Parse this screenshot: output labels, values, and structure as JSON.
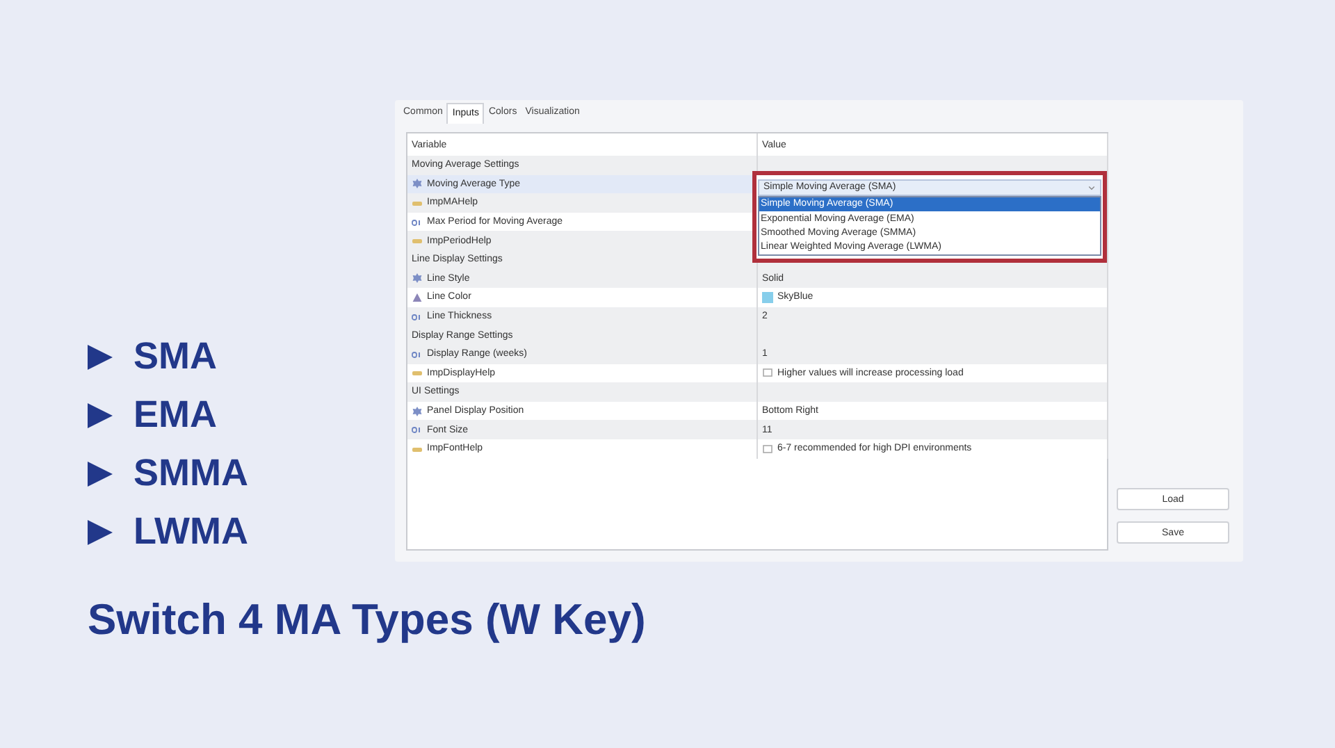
{
  "slide": {
    "bullets": [
      {
        "label": "SMA"
      },
      {
        "label": "EMA"
      },
      {
        "label": "SMMA"
      },
      {
        "label": "LWMA"
      }
    ],
    "caption": "Switch 4 MA Types (W Key)"
  },
  "dialog": {
    "tabs": [
      {
        "label": "Common",
        "selected": false
      },
      {
        "label": "Inputs",
        "selected": true
      },
      {
        "label": "Colors",
        "selected": false
      },
      {
        "label": "Visualization",
        "selected": false
      }
    ],
    "table": {
      "columns": [
        "Variable",
        "Value"
      ],
      "rows": [
        {
          "kind": "group",
          "label": "Moving Average Settings"
        },
        {
          "kind": "enum",
          "variable": "Moving Average Type",
          "selected": true,
          "dropdown": {
            "value": "Simple Moving Average (SMA)",
            "options": [
              {
                "label": "Simple Moving Average (SMA)",
                "selected": true
              },
              {
                "label": "Exponential Moving Average (EMA)",
                "selected": false
              },
              {
                "label": "Smoothed Moving Average (SMMA)",
                "selected": false
              },
              {
                "label": "Linear Weighted Moving Average (LWMA)",
                "selected": false
              }
            ]
          }
        },
        {
          "kind": "string",
          "variable": "ImpMAHelp",
          "selected": false
        },
        {
          "kind": "int",
          "variable": "Max Period for Moving Average",
          "selected": false
        },
        {
          "kind": "string",
          "variable": "ImpPeriodHelp",
          "selected": false
        },
        {
          "kind": "group",
          "label": "Line Display Settings"
        },
        {
          "kind": "enum",
          "variable": "Line Style",
          "selected": false,
          "value": "Solid"
        },
        {
          "kind": "color",
          "variable": "Line Color",
          "selected": false,
          "value": "SkyBlue",
          "color": "#87ceeb"
        },
        {
          "kind": "int",
          "variable": "Line Thickness",
          "selected": false,
          "value": "2"
        },
        {
          "kind": "group",
          "label": "Display Range Settings"
        },
        {
          "kind": "int",
          "variable": "Display Range (weeks)",
          "selected": false,
          "value": "1"
        },
        {
          "kind": "string",
          "variable": "ImpDisplayHelp",
          "selected": false,
          "value": "Higher values will increase processing load"
        },
        {
          "kind": "group",
          "label": "UI Settings"
        },
        {
          "kind": "enum",
          "variable": "Panel Display Position",
          "selected": false,
          "value": "Bottom Right"
        },
        {
          "kind": "int",
          "variable": "Font Size",
          "selected": false,
          "value": "11"
        },
        {
          "kind": "string",
          "variable": "ImpFontHelp",
          "selected": false,
          "value": "6-7 recommended for high DPI environments"
        }
      ]
    },
    "buttons": [
      "Load",
      "Save"
    ]
  }
}
